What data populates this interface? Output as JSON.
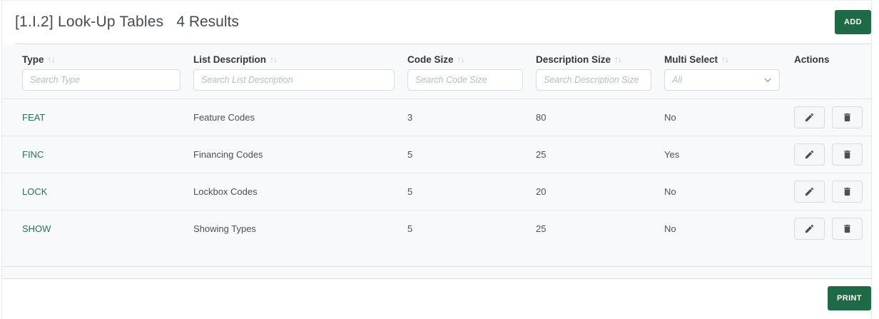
{
  "header": {
    "title": "[1.I.2] Look-Up Tables",
    "results_count": "4 Results",
    "add_label": "ADD"
  },
  "table": {
    "sort_icon": "↑↓",
    "columns": [
      {
        "label": "Type",
        "sortable": true,
        "placeholder": "Search Type"
      },
      {
        "label": "List Description",
        "sortable": true,
        "placeholder": "Search List Description"
      },
      {
        "label": "Code Size",
        "sortable": true,
        "placeholder": "Search Code Size"
      },
      {
        "label": "Description Size",
        "sortable": true,
        "placeholder": "Search Description Size"
      },
      {
        "label": "Multi Select",
        "sortable": true,
        "filter_value": "All"
      },
      {
        "label": "Actions",
        "sortable": false
      }
    ],
    "rows": [
      {
        "type": "FEAT",
        "list_description": "Feature Codes",
        "code_size": "3",
        "description_size": "80",
        "multi_select": "No"
      },
      {
        "type": "FINC",
        "list_description": "Financing Codes",
        "code_size": "5",
        "description_size": "25",
        "multi_select": "Yes"
      },
      {
        "type": "LOCK",
        "list_description": "Lockbox Codes",
        "code_size": "5",
        "description_size": "20",
        "multi_select": "No"
      },
      {
        "type": "SHOW",
        "list_description": "Showing Types",
        "code_size": "5",
        "description_size": "25",
        "multi_select": "No"
      }
    ]
  },
  "footer": {
    "print_label": "PRINT"
  },
  "colors": {
    "accent_green": "#1e6946",
    "link_green": "#2b6e54",
    "section_bg": "#f8f9fa"
  }
}
